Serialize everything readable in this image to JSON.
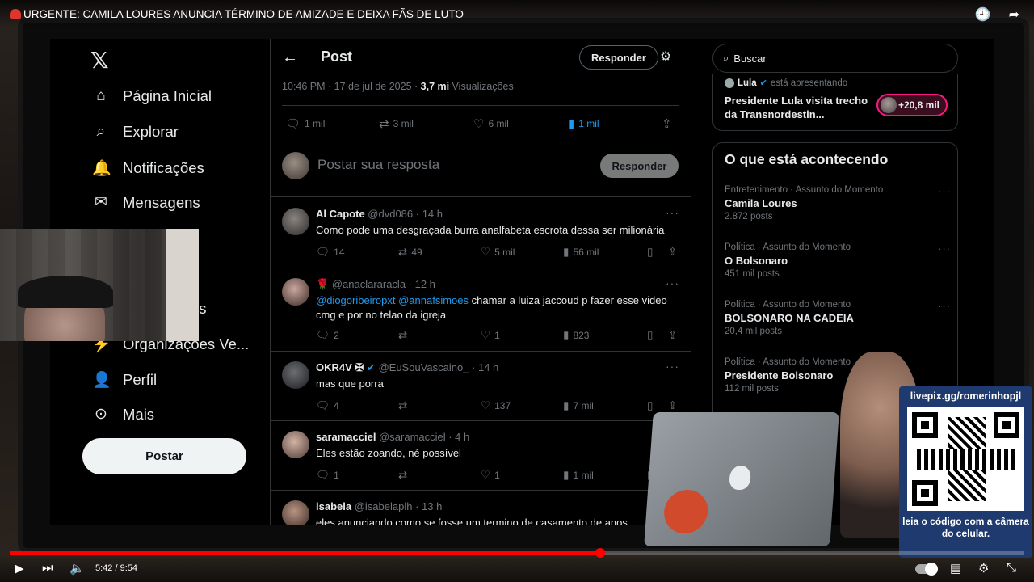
{
  "video": {
    "title": "URGENTE: CAMILA LOURES ANUNCIA TÉRMINO DE AMIZADE E DEIXA FÃS DE LUTO",
    "time": "5:42 / 9:54",
    "progress": 0.582
  },
  "nav": {
    "logo": "𝕏",
    "items": [
      {
        "icon": "home-icon",
        "glyph": "⌂",
        "label": "Página Inicial"
      },
      {
        "icon": "search-icon",
        "glyph": "⌕",
        "label": "Explorar"
      },
      {
        "icon": "bell-icon",
        "glyph": "🔔",
        "label": "Notificações"
      },
      {
        "icon": "mail-icon",
        "glyph": "✉",
        "label": "Mensagens"
      },
      {
        "icon": "communities-icon",
        "glyph": "",
        "label": "es"
      },
      {
        "icon": "lightning-icon",
        "glyph": "⚡",
        "label": "Organizações Ve..."
      },
      {
        "icon": "profile-icon",
        "glyph": "👤",
        "label": "Perfil"
      },
      {
        "icon": "more-icon",
        "glyph": "⊙",
        "label": "Mais"
      }
    ],
    "post_button": "Postar"
  },
  "post": {
    "header_title": "Post",
    "reply_top": "Responder",
    "date": "10:46 PM · 17 de jul de 2025 · ",
    "views_count": "3,7 mi",
    "views_label": " Visualizações",
    "stats": {
      "replies": "1 mil",
      "retweets": "3 mil",
      "likes": "6 mil",
      "bookmarks": "1 mil"
    },
    "reply_placeholder": "Postar sua resposta",
    "reply_button": "Responder"
  },
  "replies": [
    {
      "name": "Al Capote",
      "handle": "@dvd086 · 14 h",
      "text": "Como pode uma desgraçada burra analfabeta escrota dessa ser milionária",
      "replies": "14",
      "retweets": "49",
      "likes": "5 mil",
      "views": "56 mil"
    },
    {
      "name": "🌹",
      "handle": "@anaclararacla · 12 h",
      "mention1": "@diogoribeiropxt",
      "mention2": "@annafsimoes",
      "text": " chamar a luiza jaccoud p fazer esse video cmg e por no telao da igreja",
      "replies": "2",
      "retweets": "",
      "likes": "1",
      "views": "823"
    },
    {
      "name": "OKR4V ✠",
      "handle": "@EuSouVascaino_ · 14 h",
      "text": "mas que porra",
      "replies": "4",
      "retweets": "",
      "likes": "137",
      "views": "7 mil"
    },
    {
      "name": "saramacciel",
      "handle": "@saramacciel · 4 h",
      "text": "Eles estão zoando, né possível",
      "replies": "1",
      "retweets": "",
      "likes": "1",
      "views": "1 mil"
    },
    {
      "name": "isabela",
      "handle": "@isabelaplh · 13 h",
      "text": "eles anunciando como se fosse um termino de casamento de anos"
    }
  ],
  "right": {
    "search_placeholder": "Buscar",
    "live": {
      "host": "Lula",
      "status": "está apresentando",
      "title": "Presidente Lula visita trecho da Transnordestin...",
      "count": "+20,8 mil"
    },
    "trends_title": "O que está acontecendo",
    "trends": [
      {
        "cat": "Entretenimento · Assunto do Momento",
        "name": "Camila Loures",
        "count": "2.872 posts"
      },
      {
        "cat": "Política · Assunto do Momento",
        "name": "O Bolsonaro",
        "count": "451 mil posts"
      },
      {
        "cat": "Política · Assunto do Momento",
        "name": "BOLSONARO NA CADEIA",
        "count": "20,4 mil posts"
      },
      {
        "cat": "Política · Assunto do Momento",
        "name": "Presidente Bolsonaro",
        "count": "112 mil posts"
      }
    ]
  },
  "overlay": {
    "qr_url": "livepix.gg/romerinhopjl",
    "qr_caption": "leia o código com a câmera do celular."
  },
  "colors": {
    "accent": "#1d9bf0",
    "progress": "#ff0000",
    "live": "#f91880"
  }
}
